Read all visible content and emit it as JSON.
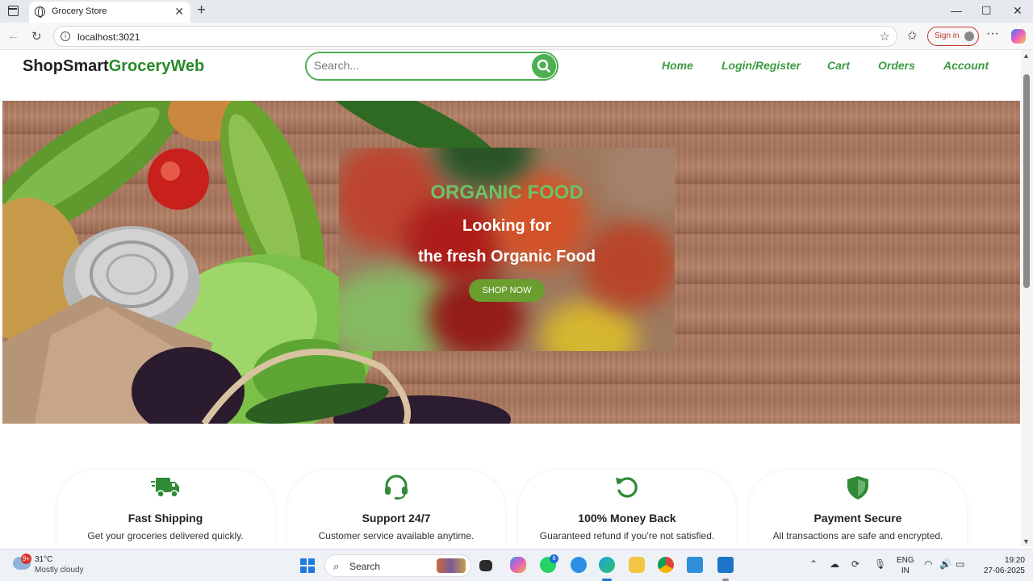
{
  "browser": {
    "tab_title": "Grocery Store",
    "url": "localhost:3021",
    "sign_in_label": "Sign in"
  },
  "site": {
    "brand_part1": "ShopSmart",
    "brand_part2": "GroceryWeb",
    "search_placeholder": "Search...",
    "nav": [
      "Home",
      "Login/Register",
      "Cart",
      "Orders",
      "Account"
    ],
    "accent_color": "#4caf50"
  },
  "hero": {
    "kicker": "ORGANIC FOOD",
    "line1": "Looking for",
    "line2": "the fresh Organic Food",
    "button_label": "SHOP NOW"
  },
  "features": [
    {
      "icon": "truck-icon",
      "title": "Fast Shipping",
      "desc": "Get your groceries delivered quickly."
    },
    {
      "icon": "headset-icon",
      "title": "Support 24/7",
      "desc": "Customer service available anytime."
    },
    {
      "icon": "refresh-icon",
      "title": "100% Money Back",
      "desc": "Guaranteed refund if you're not satisfied."
    },
    {
      "icon": "shield-icon",
      "title": "Payment Secure",
      "desc": "All transactions are safe and encrypted."
    }
  ],
  "taskbar": {
    "weather_badge": "9+",
    "temperature": "31°C",
    "weather_desc": "Mostly cloudy",
    "search_label": "Search",
    "whatsapp_badge": "6",
    "lang_line1": "ENG",
    "lang_line2": "IN",
    "time": "19:20",
    "date": "27-06-2025"
  }
}
